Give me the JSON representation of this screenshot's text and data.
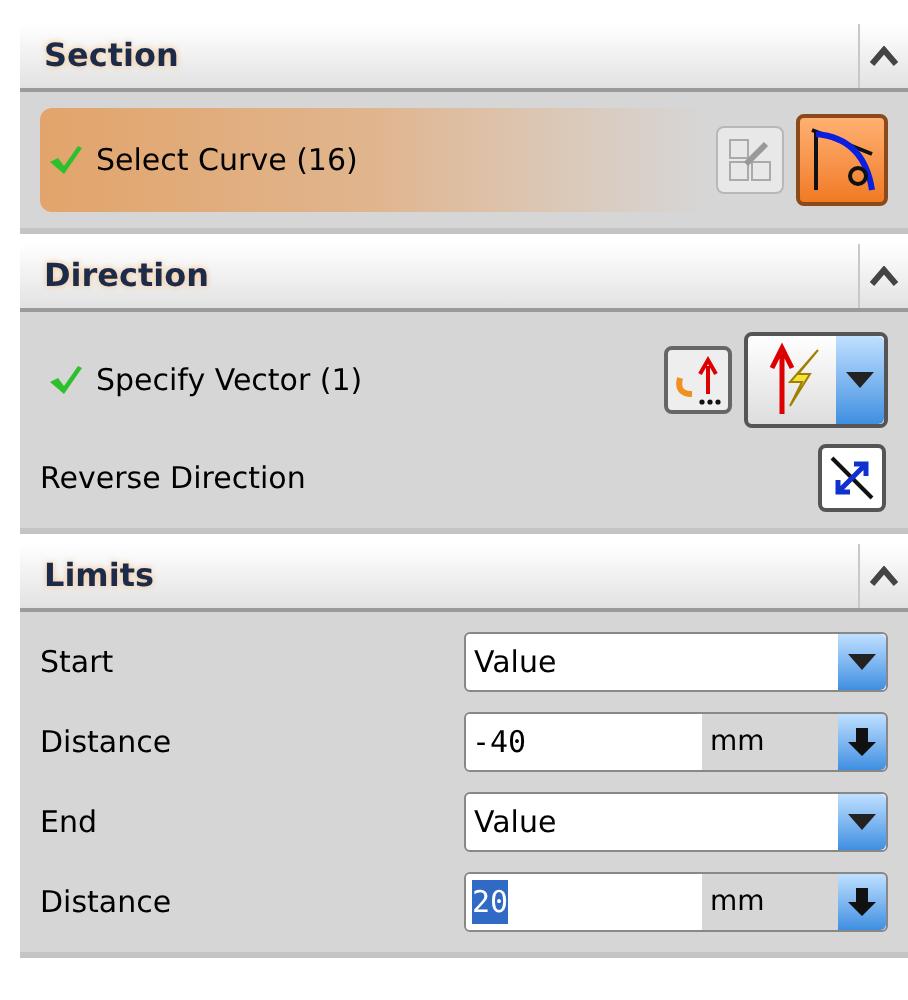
{
  "sections": [
    {
      "title": "Section",
      "expanded": true,
      "rows": [
        {
          "kind": "selection",
          "label": "Select Curve (16)",
          "done": true,
          "selected": true
        }
      ]
    },
    {
      "title": "Direction",
      "expanded": true,
      "rows": [
        {
          "kind": "vector",
          "label": "Specify Vector (1)",
          "done": true,
          "selected": false
        },
        {
          "kind": "reverse",
          "label": "Reverse Direction"
        }
      ]
    },
    {
      "title": "Limits",
      "expanded": true,
      "rows": [
        {
          "kind": "dropdown",
          "label": "Start",
          "value": "Value"
        },
        {
          "kind": "length",
          "label": "Distance",
          "value": "-40",
          "unit": "mm",
          "value_selected": false
        },
        {
          "kind": "dropdown",
          "label": "End",
          "value": "Value"
        },
        {
          "kind": "length",
          "label": "Distance",
          "value": "20",
          "unit": "mm",
          "value_selected": true
        }
      ]
    }
  ]
}
